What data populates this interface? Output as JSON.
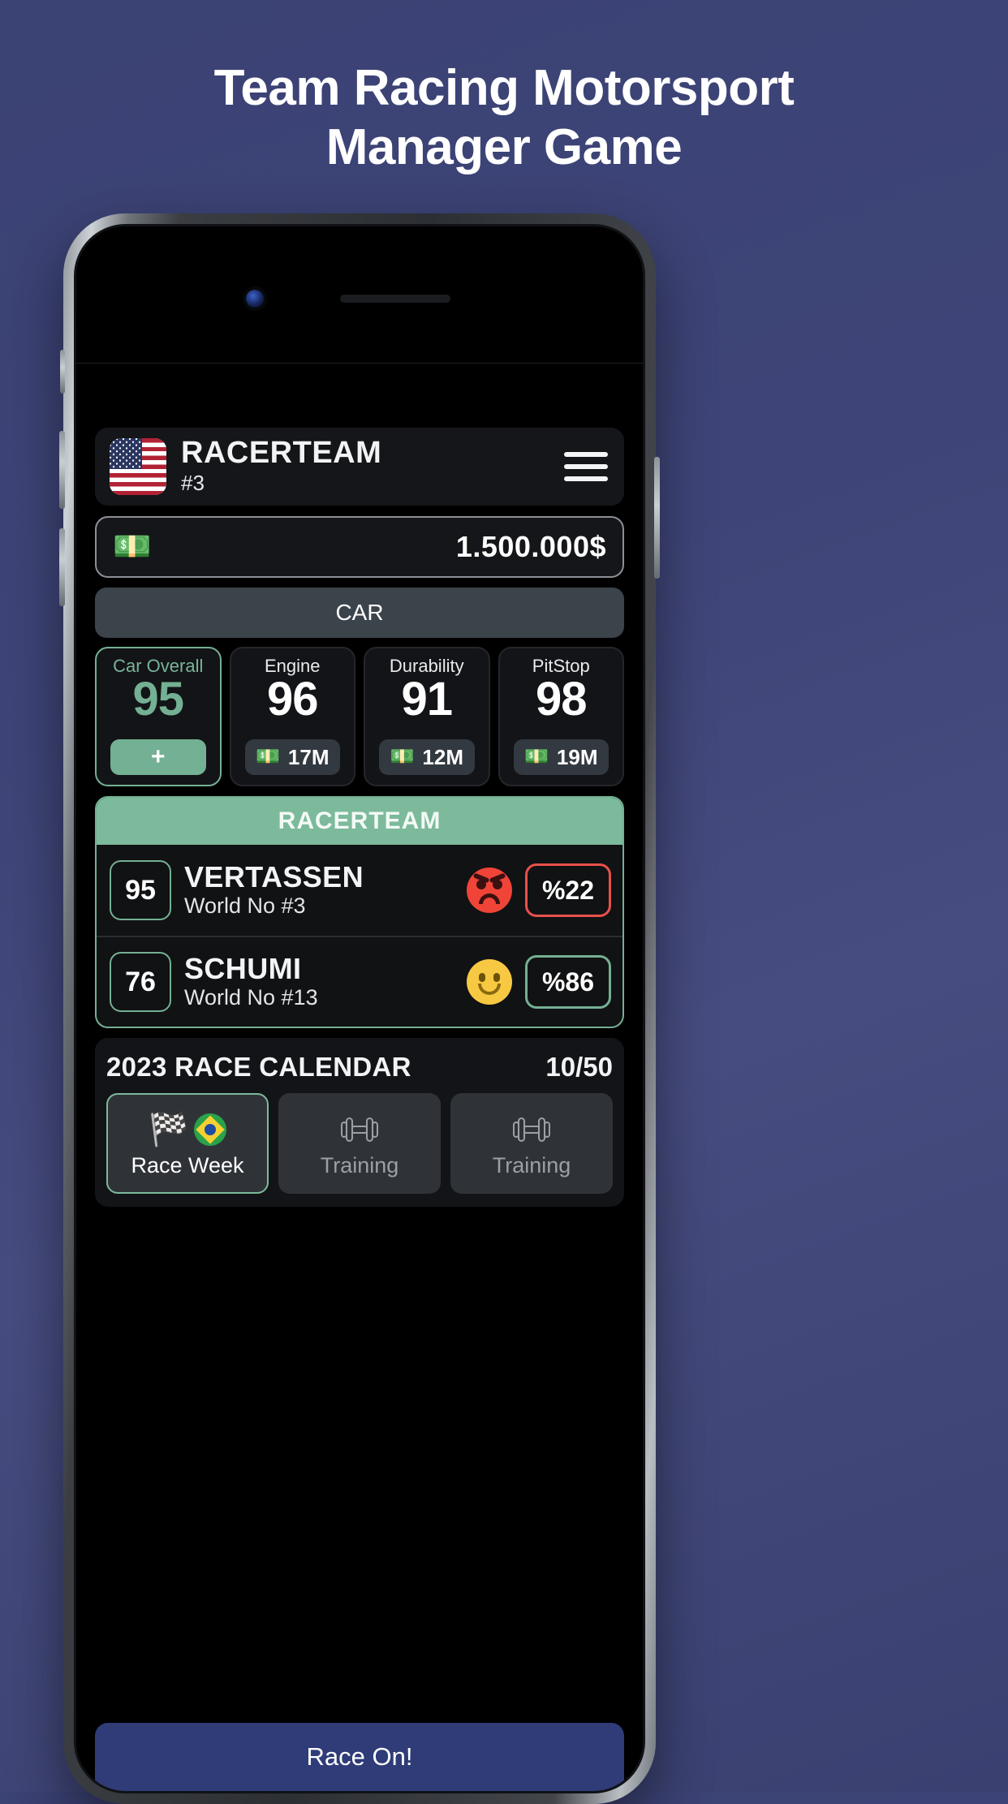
{
  "promo": {
    "line1": "Team Racing Motorsport",
    "line2": "Manager Game"
  },
  "app": {
    "header": {
      "flag_icon": "us-flag-icon",
      "team_name": "RACERTEAM",
      "team_rank": "#3",
      "menu_icon": "hamburger-menu-icon"
    },
    "money": {
      "icon": "banknote-icon",
      "amount": "1.500.000$"
    },
    "tabs": [
      {
        "label": "CAR"
      }
    ],
    "stats": [
      {
        "name": "car-overall",
        "label": "Car Overall",
        "value": "95",
        "action": "+",
        "primary": true
      },
      {
        "name": "engine",
        "label": "Engine",
        "value": "96",
        "price": "17M",
        "primary": false
      },
      {
        "name": "durability",
        "label": "Durability",
        "value": "91",
        "price": "12M",
        "primary": false
      },
      {
        "name": "pitstop",
        "label": "PitStop",
        "value": "98",
        "price": "19M",
        "primary": false
      }
    ],
    "drivers_panel": {
      "title": "RACERTEAM",
      "drivers": [
        {
          "overall": "95",
          "name": "VERTASSEN",
          "world_rank": "World No #3",
          "mood": "angry",
          "morale": "%22",
          "morale_state": "bad"
        },
        {
          "overall": "76",
          "name": "SCHUMI",
          "world_rank": "World No #13",
          "mood": "happy",
          "morale": "%86",
          "morale_state": "good"
        }
      ]
    },
    "calendar": {
      "title": "2023 RACE CALENDAR",
      "counter": "10/50",
      "tiles": [
        {
          "label": "Race Week",
          "icon": "checkered-flag-icon",
          "flag": "brazil-flag-icon",
          "active": true
        },
        {
          "label": "Training",
          "icon": "dumbbell-icon",
          "active": false
        },
        {
          "label": "Training",
          "icon": "dumbbell-icon",
          "active": false
        }
      ]
    },
    "primary_action": {
      "label": "Race On!"
    }
  },
  "colors": {
    "background": "#3e4477",
    "accent_green": "#74b093",
    "accent_blue": "#2f3c78",
    "danger_red": "#e8514a"
  }
}
